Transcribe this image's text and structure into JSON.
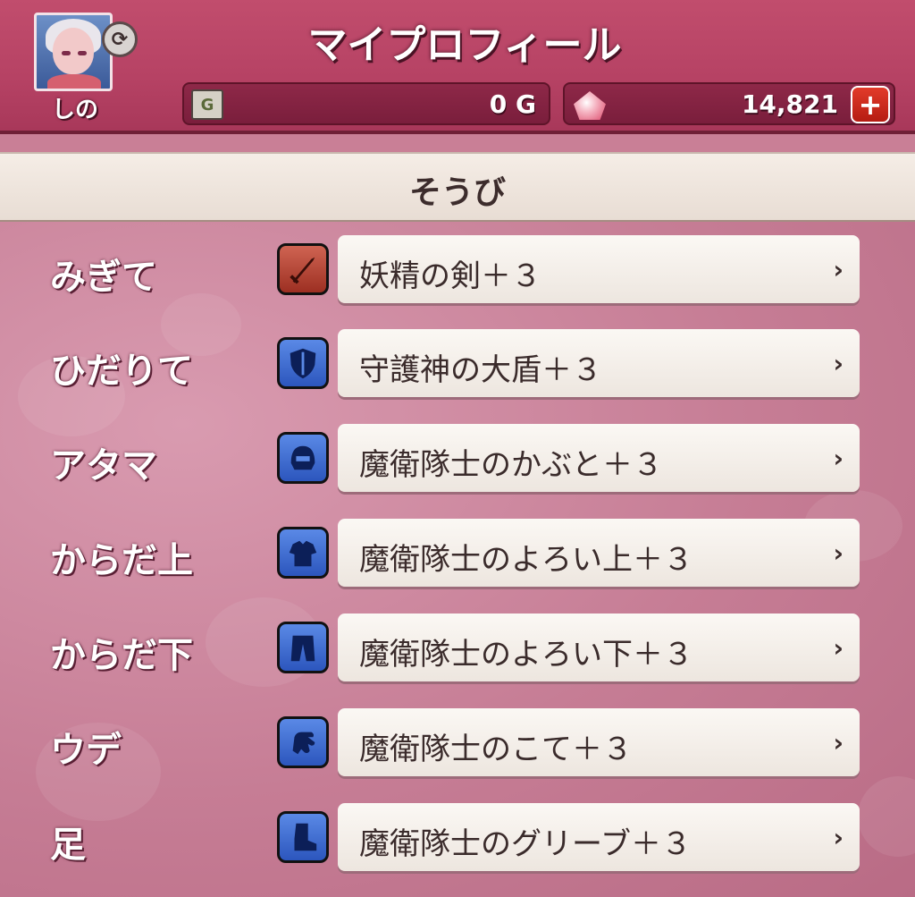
{
  "header": {
    "title": "マイプロフィール",
    "player_name": "しの",
    "refresh_symbol": "⟳",
    "gold": {
      "icon_text": "G",
      "value": "0 G"
    },
    "gems": {
      "value": "14,821"
    },
    "plus_label": "+"
  },
  "section": {
    "title": "そうび"
  },
  "equipment": [
    {
      "slot": "みぎて",
      "item": "妖精の剣＋３",
      "icon": "sword-icon",
      "color": "#b8382b"
    },
    {
      "slot": "ひだりて",
      "item": "守護神の大盾＋３",
      "icon": "shield-icon",
      "color": "#2c56bd"
    },
    {
      "slot": "アタマ",
      "item": "魔衛隊士のかぶと＋３",
      "icon": "helmet-icon",
      "color": "#2c56bd"
    },
    {
      "slot": "からだ上",
      "item": "魔衛隊士のよろい上＋３",
      "icon": "armor-top-icon",
      "color": "#2c56bd"
    },
    {
      "slot": "からだ下",
      "item": "魔衛隊士のよろい下＋３",
      "icon": "armor-bottom-icon",
      "color": "#2c56bd"
    },
    {
      "slot": "ウデ",
      "item": "魔衛隊士のこて＋３",
      "icon": "gauntlet-icon",
      "color": "#2c56bd"
    },
    {
      "slot": "足",
      "item": "魔衛隊士のグリーブ＋３",
      "icon": "boots-icon",
      "color": "#2c56bd"
    }
  ],
  "chevron": "›"
}
